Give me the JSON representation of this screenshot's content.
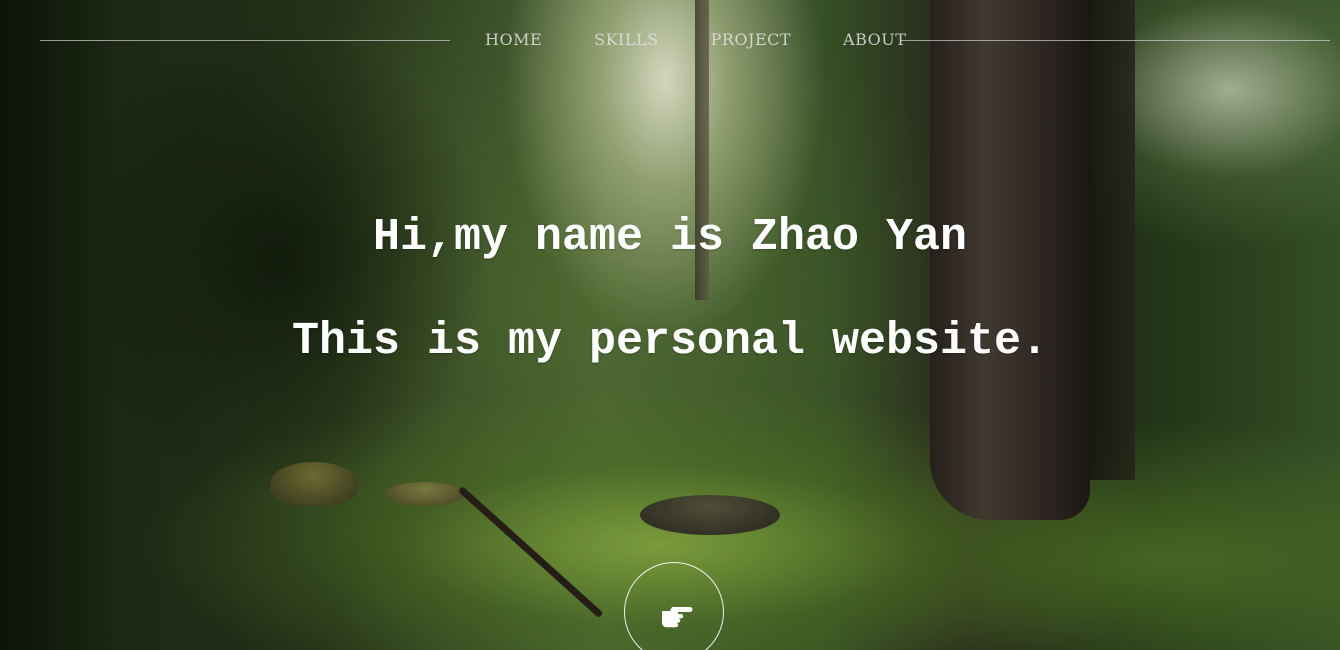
{
  "nav": {
    "items": [
      {
        "label": "HOME"
      },
      {
        "label": "SKILLS"
      },
      {
        "label": "PROJECT"
      },
      {
        "label": "ABOUT"
      }
    ]
  },
  "hero": {
    "greeting": "Hi,my name is Zhao Yan",
    "tagline": "This is my personal website."
  },
  "scroll_hint": {
    "icon": "pointing-hand-icon",
    "color": "#ffffff"
  }
}
